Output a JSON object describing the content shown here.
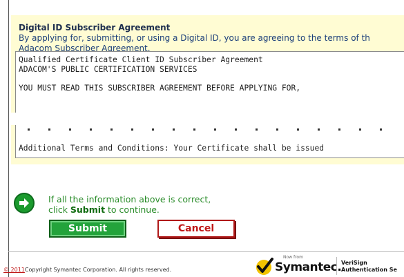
{
  "agreement": {
    "title": "Digital ID Subscriber Agreement",
    "intro_line1": "By applying for, submitting, or using a Digital ID, you are agreeing to the terms of th",
    "intro_line2": "Adacom Subscriber Agreement.",
    "text_lines": [
      "     Qualified Certificate Client ID Subscriber Agreement",
      "          ADACOM'S PUBLIC CERTIFICATION SERVICES",
      "YOU MUST READ THIS SUBSCRIBER AGREEMENT BEFORE APPLYING FOR,",
      "Additional Terms and Conditions: Your Certificate shall be issued"
    ]
  },
  "confirm": {
    "line1": "If all the information above is correct,",
    "line2_prefix": "click ",
    "line2_bold": "Submit",
    "line2_suffix": " to continue."
  },
  "buttons": {
    "submit_label": "Submit",
    "cancel_label": "Cancel"
  },
  "footer": {
    "year": "© 2011",
    "copyright": "Copyright Symantec Corporation. All rights reserved.",
    "now_from": "Now from",
    "brand": "Symantec.",
    "verisign_line1": "VeriSign",
    "verisign_line2": "Authentication Se"
  },
  "colors": {
    "panel_bg": "#fffcd3",
    "submit_green": "#23a33b",
    "cancel_red": "#c01818",
    "confirm_text": "#2b8d2b"
  },
  "icons": [
    "arrow-right-circle-icon",
    "symantec-checkmark-icon"
  ]
}
